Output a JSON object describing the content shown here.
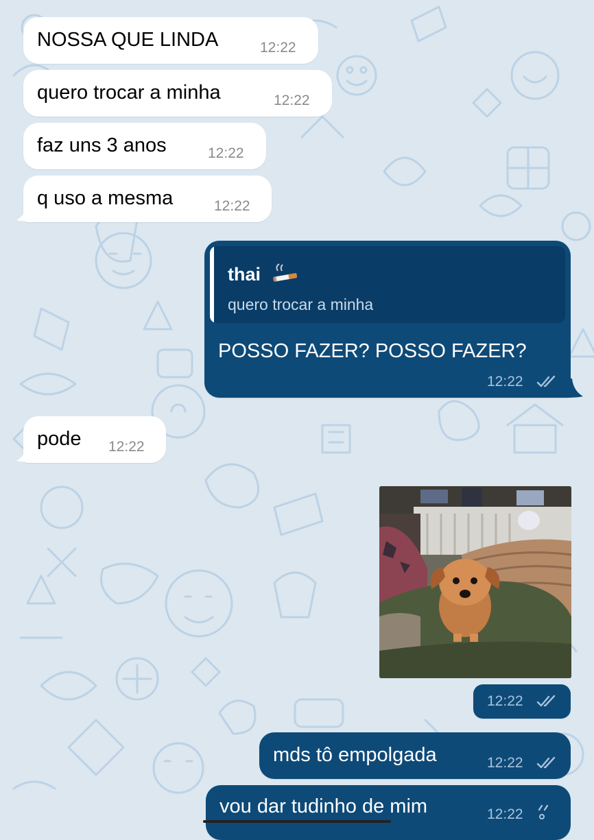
{
  "theme": {
    "wallpaper": "#dce7f0",
    "incoming_bubble": "#ffffff",
    "outgoing_bubble": "#0e4a78",
    "pattern": "#b9d0e4"
  },
  "messages": [
    {
      "direction": "in",
      "text": "NOSSA QUE LINDA",
      "time": "12:22"
    },
    {
      "direction": "in",
      "text": "quero trocar a minha",
      "time": "12:22"
    },
    {
      "direction": "in",
      "text": "faz uns 3 anos",
      "time": "12:22"
    },
    {
      "direction": "in",
      "text": "q uso a mesma",
      "time": "12:22"
    },
    {
      "direction": "out",
      "reply_to": {
        "name": "thai",
        "name_emoji": "cigarette",
        "text": "quero trocar a minha"
      },
      "text": "POSSO FAZER? POSSO FAZER?",
      "time": "12:22",
      "status": "read"
    },
    {
      "direction": "in",
      "text": "pode",
      "time": "12:22"
    },
    {
      "direction": "out",
      "media": "photo of a small brown puppy on a green couch",
      "time": "12:22",
      "status": "read"
    },
    {
      "direction": "out",
      "text": "mds tô empolgada",
      "time": "12:22",
      "status": "read"
    },
    {
      "direction": "out",
      "text": "vou dar tudinho de mim",
      "time": "12:22",
      "status": "sending"
    }
  ]
}
